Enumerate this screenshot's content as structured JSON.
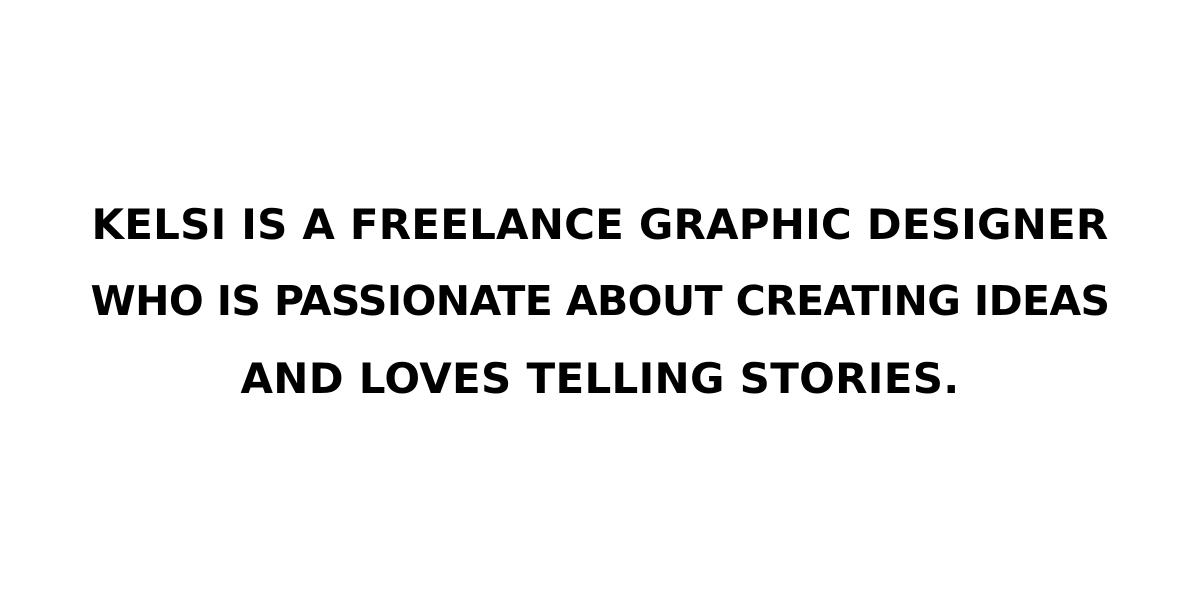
{
  "statement": {
    "lines": [
      "KELSI IS A FREELANCE GRAPHIC DESIGNER",
      "WHO IS PASSIONATE ABOUT CREATING IDEAS",
      "AND LOVES TELLING STORIES."
    ]
  },
  "colors": {
    "background": "#ffffff",
    "text": "#000000"
  }
}
